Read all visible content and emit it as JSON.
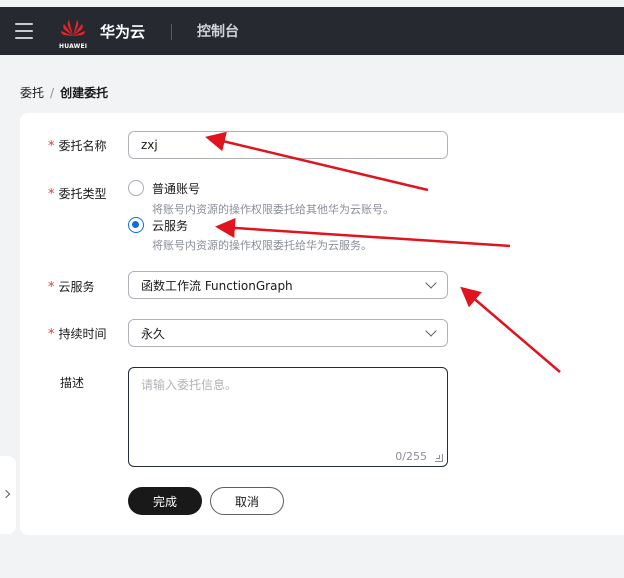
{
  "header": {
    "brand": "华为云",
    "logo_text": "HUAWEI",
    "console": "控制台",
    "menu_icon": "hamburger-menu-icon",
    "logo_icon": "huawei-logo-icon",
    "background": "#262930"
  },
  "breadcrumb": {
    "parent": "委托",
    "separator": "/",
    "current": "创建委托"
  },
  "form": {
    "required_mark": "*",
    "name": {
      "label": "委托名称",
      "value": "zxj"
    },
    "type": {
      "label": "委托类型",
      "options": [
        {
          "label": "普通账号",
          "desc": "将账号内资源的操作权限委托给其他华为云账号。",
          "selected": false
        },
        {
          "label": "云服务",
          "desc": "将账号内资源的操作权限委托给华为云服务。",
          "selected": true
        }
      ]
    },
    "cloud_service": {
      "label": "云服务",
      "value": "函数工作流 FunctionGraph"
    },
    "duration": {
      "label": "持续时间",
      "value": "永久"
    },
    "description": {
      "label": "描述",
      "placeholder": "请输入委托信息。",
      "counter": "0/255"
    },
    "submit": "完成",
    "cancel": "取消"
  },
  "colors": {
    "accent": "#0a6edc",
    "required": "#e6363a",
    "annotation_arrow": "#e0141e"
  }
}
